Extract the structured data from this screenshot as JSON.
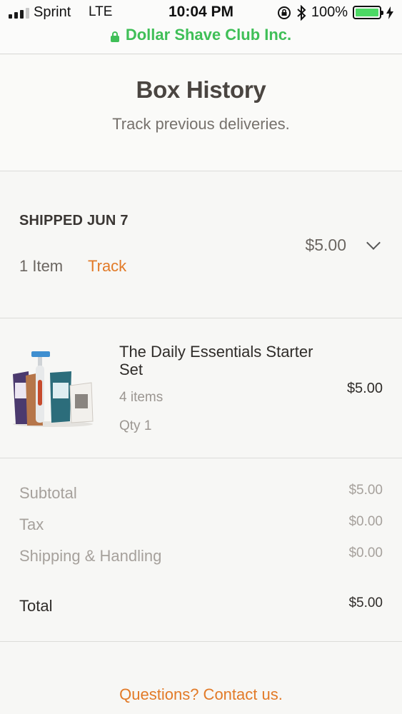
{
  "status_bar": {
    "carrier": "Sprint",
    "network": "LTE",
    "time": "10:04 PM",
    "battery": "100%",
    "battery_level": 1.0
  },
  "browser": {
    "site_name": "Dollar Shave Club Inc."
  },
  "header": {
    "title": "Box History",
    "subtitle": "Track previous deliveries."
  },
  "shipment": {
    "status": "SHIPPED JUN 7",
    "item_count": "1 Item",
    "track_label": "Track",
    "price": "$5.00"
  },
  "product": {
    "name": "The Daily Essentials Starter Set",
    "contents": "4 items",
    "quantity": "Qty 1",
    "price": "$5.00"
  },
  "totals": {
    "subtotal_label": "Subtotal",
    "subtotal_value": "$5.00",
    "tax_label": "Tax",
    "tax_value": "$0.00",
    "shipping_label": "Shipping & Handling",
    "shipping_value": "$0.00",
    "total_label": "Total",
    "total_value": "$5.00"
  },
  "footer": {
    "contact_label": "Questions? Contact us."
  },
  "colors": {
    "accent_orange": "#e27a27",
    "secure_green": "#3fbf57",
    "battery_green": "#4cd964"
  }
}
